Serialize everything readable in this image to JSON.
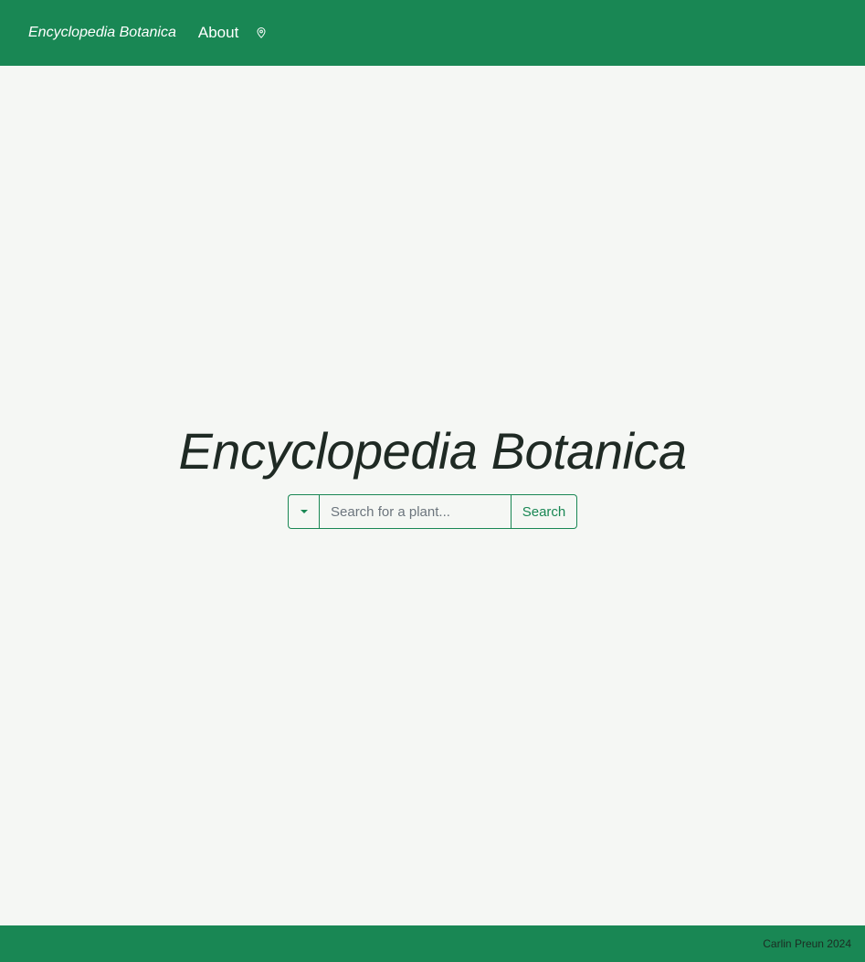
{
  "navbar": {
    "brand": "Encyclopedia Botanica",
    "about_label": "About",
    "location_icon": "map-pin-icon"
  },
  "hero": {
    "title": "Encyclopedia Botanica"
  },
  "search": {
    "placeholder": "Search for a plant...",
    "value": "",
    "button_label": "Search",
    "dropdown_icon": "caret-down-icon"
  },
  "footer": {
    "text": "Carlin Preun 2024"
  },
  "colors": {
    "primary": "#198754",
    "background": "#f5f7f4",
    "text": "#1f2a24"
  }
}
